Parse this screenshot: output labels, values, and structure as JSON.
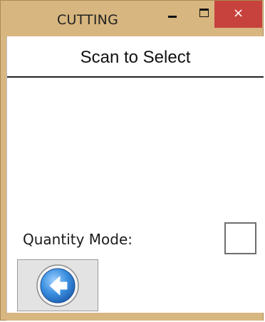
{
  "window": {
    "title": "CUTTING",
    "frame_color": "#d7b67f",
    "close_button_color": "#c7423d",
    "controls": {
      "minimize_icon": "minimize-icon",
      "maximize_icon": "maximize-icon",
      "close_label": "×"
    }
  },
  "screen": {
    "title": "Scan to Select"
  },
  "quantity_mode": {
    "label": "Quantity Mode:",
    "checked": false
  },
  "back_button": {
    "icon": "back-arrow-icon",
    "accent_color": "#3a8fe0"
  }
}
